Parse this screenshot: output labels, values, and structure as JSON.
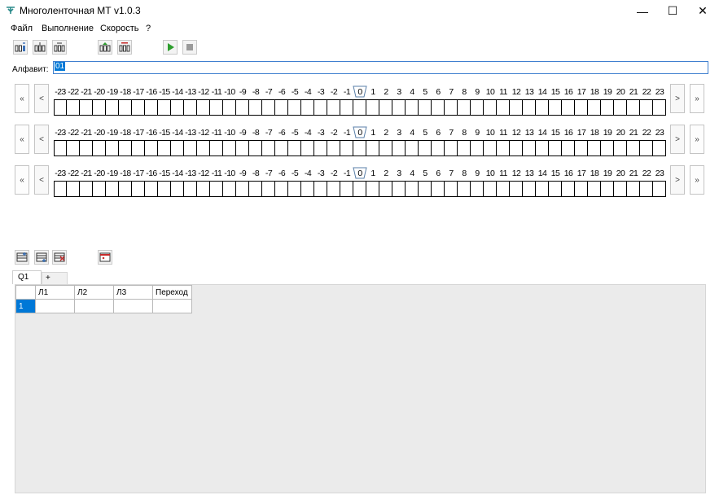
{
  "window": {
    "title": "Многоленточная МТ v1.0.3",
    "minimize_glyph": "—",
    "maximize_glyph": "☐",
    "close_glyph": "✕",
    "app_icon": "turing-tape-icon"
  },
  "menu": [
    "Файл",
    "Выполнение",
    "Скорость",
    "?"
  ],
  "toolbar": {
    "buttons": [
      {
        "name": "add-tape-icon"
      },
      {
        "name": "insert-tape-icon"
      },
      {
        "name": "remove-tape-icon"
      },
      {
        "name": "load-tapes-icon"
      },
      {
        "name": "clear-tapes-icon"
      },
      {
        "name": "run-icon"
      },
      {
        "name": "stop-icon"
      }
    ]
  },
  "alphabet": {
    "label": "Алфавит:",
    "value": "01"
  },
  "tapes": {
    "count": 3,
    "first_left": "«",
    "left": "<",
    "right": ">",
    "last_right": "»",
    "head_index": 0,
    "labels": [
      "-23",
      "-22",
      "-21",
      "-20",
      "-19",
      "-18",
      "-17",
      "-16",
      "-15",
      "-14",
      "-13",
      "-12",
      "-11",
      "-10",
      "-9",
      "-8",
      "-7",
      "-6",
      "-5",
      "-4",
      "-3",
      "-2",
      "-1",
      "0",
      "1",
      "2",
      "3",
      "4",
      "5",
      "6",
      "7",
      "8",
      "9",
      "10",
      "11",
      "12",
      "13",
      "14",
      "15",
      "16",
      "17",
      "18",
      "19",
      "20",
      "21",
      "22",
      "23"
    ]
  },
  "states_toolbar": {
    "buttons": [
      {
        "name": "add-row-icon"
      },
      {
        "name": "insert-row-icon"
      },
      {
        "name": "delete-row-icon"
      },
      {
        "name": "state-window-icon"
      }
    ]
  },
  "state_tabs": [
    "Q1",
    "+"
  ],
  "transitions": {
    "columns": [
      "Л1",
      "Л2",
      "Л3",
      "Переход"
    ],
    "rows": [
      {
        "num": "1",
        "cells": [
          "",
          "",
          "",
          ""
        ]
      }
    ]
  },
  "colors": {
    "accent": "#0078d7",
    "run_green": "#2e9e2e",
    "stop_gray": "#9a9a9a"
  }
}
